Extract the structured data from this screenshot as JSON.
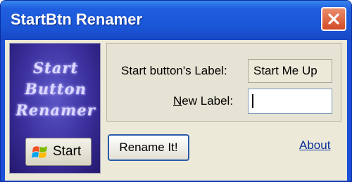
{
  "window": {
    "title": "StartBtn Renamer",
    "title_color": "#ffffff",
    "titlebar_color": "#1f5fe0",
    "close_button_color": "#d24a24"
  },
  "logo": {
    "line1": "Start",
    "line2": "Button",
    "line3": "Renamer",
    "start_button_label": "Start",
    "start_button_icon": "windows-flag-icon"
  },
  "form": {
    "current_label_caption": "Start button's Label:",
    "current_label_value": "Start Me Up",
    "new_label_caption_accel": "N",
    "new_label_caption_rest": "ew Label:",
    "new_label_value": ""
  },
  "actions": {
    "rename_button": "Rename It!",
    "about_link": "About",
    "link_color": "#0a2f9c"
  },
  "icons": {
    "close": "close-icon"
  }
}
